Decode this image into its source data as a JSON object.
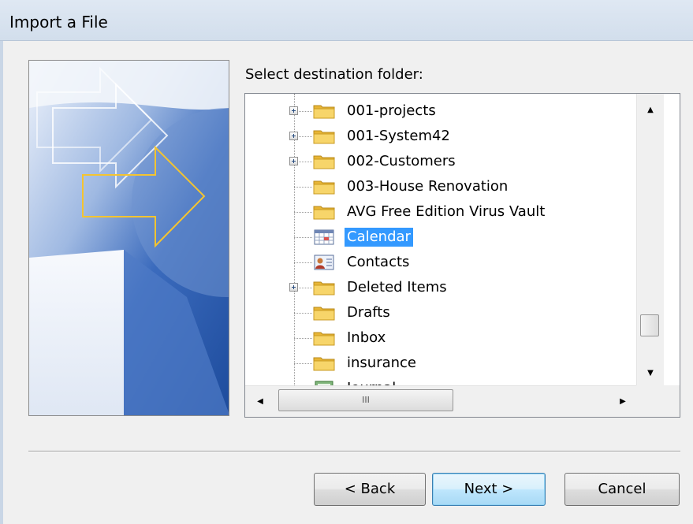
{
  "window": {
    "title": "Import a File"
  },
  "main": {
    "prompt": "Select destination folder:",
    "folders": [
      {
        "name": "001-projects",
        "icon": "folder-icon",
        "expandable": true
      },
      {
        "name": "001-System42",
        "icon": "folder-icon",
        "expandable": true
      },
      {
        "name": "002-Customers",
        "icon": "folder-icon",
        "expandable": true
      },
      {
        "name": "003-House Renovation",
        "icon": "folder-icon",
        "expandable": false
      },
      {
        "name": "AVG Free Edition Virus Vault",
        "icon": "folder-icon",
        "expandable": false
      },
      {
        "name": "Calendar",
        "icon": "calendar-icon",
        "expandable": false,
        "selected": true
      },
      {
        "name": "Contacts",
        "icon": "contacts-icon",
        "expandable": false
      },
      {
        "name": "Deleted Items",
        "icon": "folder-icon",
        "expandable": true
      },
      {
        "name": "Drafts",
        "icon": "folder-icon",
        "expandable": false
      },
      {
        "name": "Inbox",
        "icon": "folder-icon",
        "expandable": false
      },
      {
        "name": "insurance",
        "icon": "folder-icon",
        "expandable": false
      },
      {
        "name": "Journal",
        "icon": "journal-icon",
        "expandable": false
      }
    ],
    "hscroll_thumb_grip": "III"
  },
  "buttons": {
    "back": "< Back",
    "next": "Next >",
    "cancel": "Cancel"
  },
  "colors": {
    "selection": "#3399ff",
    "title_bar": "#d6e2ef",
    "folder": "#f5c84b"
  }
}
